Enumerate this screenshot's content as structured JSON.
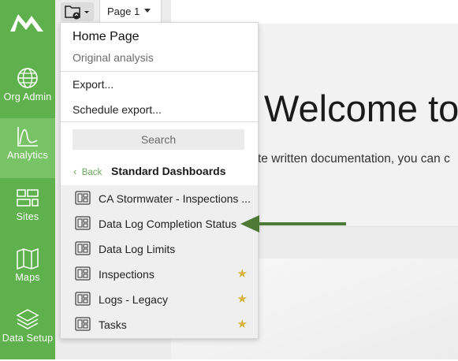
{
  "sidebar": {
    "items": [
      {
        "label": "Org Admin",
        "icon": "globe-icon"
      },
      {
        "label": "Analytics",
        "icon": "analytics-icon",
        "active": true
      },
      {
        "label": "Sites",
        "icon": "sites-icon"
      },
      {
        "label": "Maps",
        "icon": "map-icon"
      },
      {
        "label": "Data Setup",
        "icon": "layers-icon"
      }
    ]
  },
  "toolbar": {
    "page_label": "Page 1",
    "folder_icon": "folder-icon"
  },
  "main": {
    "heading": "Welcome to",
    "subtext": "te written documentation, you can c"
  },
  "dropdown": {
    "title": "Home Page",
    "subtitle": "Original analysis",
    "menu": [
      "Export...",
      "Schedule export..."
    ],
    "search_placeholder": "Search",
    "back_label": "Back",
    "section_title": "Standard Dashboards",
    "dashboards": [
      {
        "name": "CA Stormwater - Inspections ...",
        "favorite": false
      },
      {
        "name": "Data Log Completion Status",
        "favorite": false
      },
      {
        "name": "Data Log Limits",
        "favorite": false
      },
      {
        "name": "Inspections",
        "favorite": true
      },
      {
        "name": "Logs - Legacy",
        "favorite": true
      },
      {
        "name": "Tasks",
        "favorite": true
      }
    ]
  },
  "colors": {
    "sidebar": "#5fb14d",
    "sidebar_active": "#77c365",
    "star": "#d5b43a",
    "arrow": "#4d7a37"
  }
}
